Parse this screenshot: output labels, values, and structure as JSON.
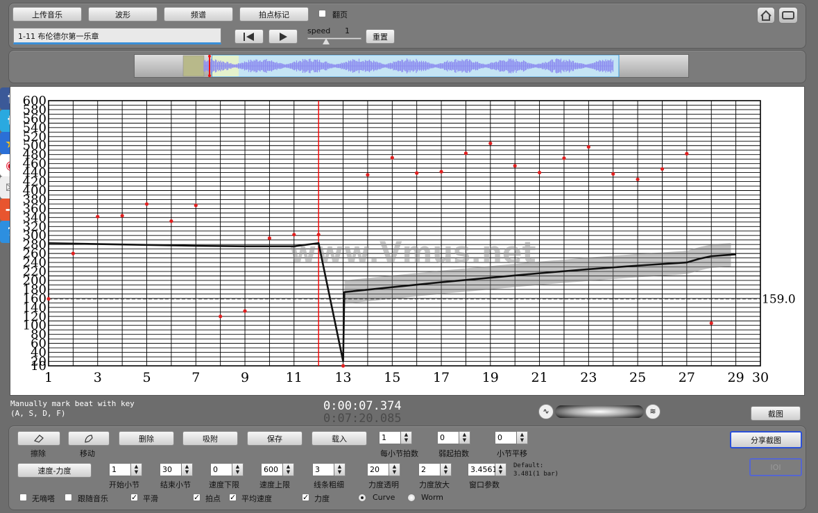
{
  "toolbar": {
    "upload": "上传音乐",
    "waveform": "波形",
    "spectrum": "频谱",
    "beat_mark": "拍点标记",
    "page_turn": "翻页",
    "page_turn_checked": false
  },
  "track": {
    "title": "1-11 布伦德尔第一乐章"
  },
  "playback": {
    "speed_label": "speed",
    "speed_value": "1",
    "speed_fraction": 0.35,
    "reset": "重置"
  },
  "overview": {
    "view_start_fraction": 0.14,
    "view_end_fraction": 1.0,
    "playhead_fraction": 0.14
  },
  "chart_data": {
    "type": "scatter",
    "xlim": [
      1,
      30
    ],
    "ylim": [
      10,
      600
    ],
    "x_ticks": [
      "1",
      "3",
      "5",
      "7",
      "9",
      "11",
      "13",
      "15",
      "17",
      "19",
      "21",
      "23",
      "25",
      "27",
      "29",
      "30"
    ],
    "y_ticks": [
      "10",
      "20",
      "40",
      "60",
      "80",
      "100",
      "120",
      "140",
      "160",
      "180",
      "200",
      "220",
      "240",
      "260",
      "280",
      "300",
      "320",
      "340",
      "360",
      "380",
      "400",
      "420",
      "440",
      "460",
      "480",
      "500",
      "520",
      "540",
      "560",
      "580",
      "600"
    ],
    "beat_points": {
      "x": [
        1,
        2,
        3,
        4,
        5,
        6,
        7,
        8,
        9,
        10,
        11,
        12,
        13,
        14,
        15,
        16,
        17,
        18,
        19,
        20,
        21,
        22,
        23,
        24,
        25,
        26,
        27,
        28
      ],
      "y": [
        159,
        260,
        342,
        344,
        370,
        332,
        367,
        120,
        132,
        294,
        302,
        302,
        10,
        435,
        473,
        439,
        442,
        483,
        505,
        455,
        440,
        472,
        497,
        437,
        425,
        448,
        482,
        105
      ]
    },
    "tempo_curve": {
      "x": [
        1,
        3,
        5,
        7,
        9,
        11,
        12,
        13,
        13.05,
        15,
        17,
        19,
        21,
        23,
        25,
        27,
        27.5,
        28,
        28.5,
        29
      ],
      "y": [
        283,
        281,
        279,
        277,
        276,
        276,
        283,
        20,
        174,
        185,
        196,
        206,
        216,
        225,
        233,
        240,
        248,
        254,
        256,
        258
      ]
    },
    "band_x_range": [
      13,
      29
    ],
    "band_half_width": 26,
    "average_line_value": 159.0,
    "average_line_label": "159.0",
    "cursor_x": 12,
    "watermark": "www.Vmus.net"
  },
  "status": {
    "hint_line1": "Manually mark beat with key",
    "hint_line2": "(A, S, D, F)",
    "current_time": "0:00:07.374",
    "total_time": "0:07:20.085",
    "screenshot": "截图"
  },
  "controls": {
    "eraser": "擦除",
    "move": "移动",
    "delete": "删除",
    "snap": "吸附",
    "save": "保存",
    "load": "载入",
    "beats_per_bar_label": "每小节拍数",
    "beats_per_bar": "1",
    "pickup_label": "弱起拍数",
    "pickup": "0",
    "bar_shift_label": "小节平移",
    "bar_shift": "0",
    "share": "分享截图",
    "ioi": "IOI",
    "mode": "速度-力度",
    "start_bar_label": "开始小节",
    "start_bar": "1",
    "end_bar_label": "结束小节",
    "end_bar": "30",
    "tempo_min_label": "速度下限",
    "tempo_min": "0",
    "tempo_max_label": "速度上限",
    "tempo_max": "600",
    "line_width_label": "线条粗细",
    "line_width": "3",
    "dyn_alpha_label": "力度透明",
    "dyn_alpha": "20",
    "dyn_zoom_label": "力度放大",
    "dyn_zoom": "2",
    "window_label": "窗口参数",
    "window": "3.4561",
    "default_line1": "Default:",
    "default_line2": "3.481(1 bar)",
    "no_click": "无嘀嗒",
    "no_click_checked": false,
    "follow": "跟随音乐",
    "follow_checked": false,
    "smooth": "平滑",
    "smooth_checked": true,
    "beats": "拍点",
    "beats_checked": true,
    "avg_tempo": "平均速度",
    "avg_tempo_checked": true,
    "dynamics": "力度",
    "dynamics_checked": true,
    "curve": "Curve",
    "curve_selected": true,
    "worm": "Worm",
    "worm_selected": false
  },
  "colors": {
    "beat": "#e02020",
    "curve": "#111111",
    "cursor": "#ff0000",
    "wave": "#8c8cf0"
  }
}
